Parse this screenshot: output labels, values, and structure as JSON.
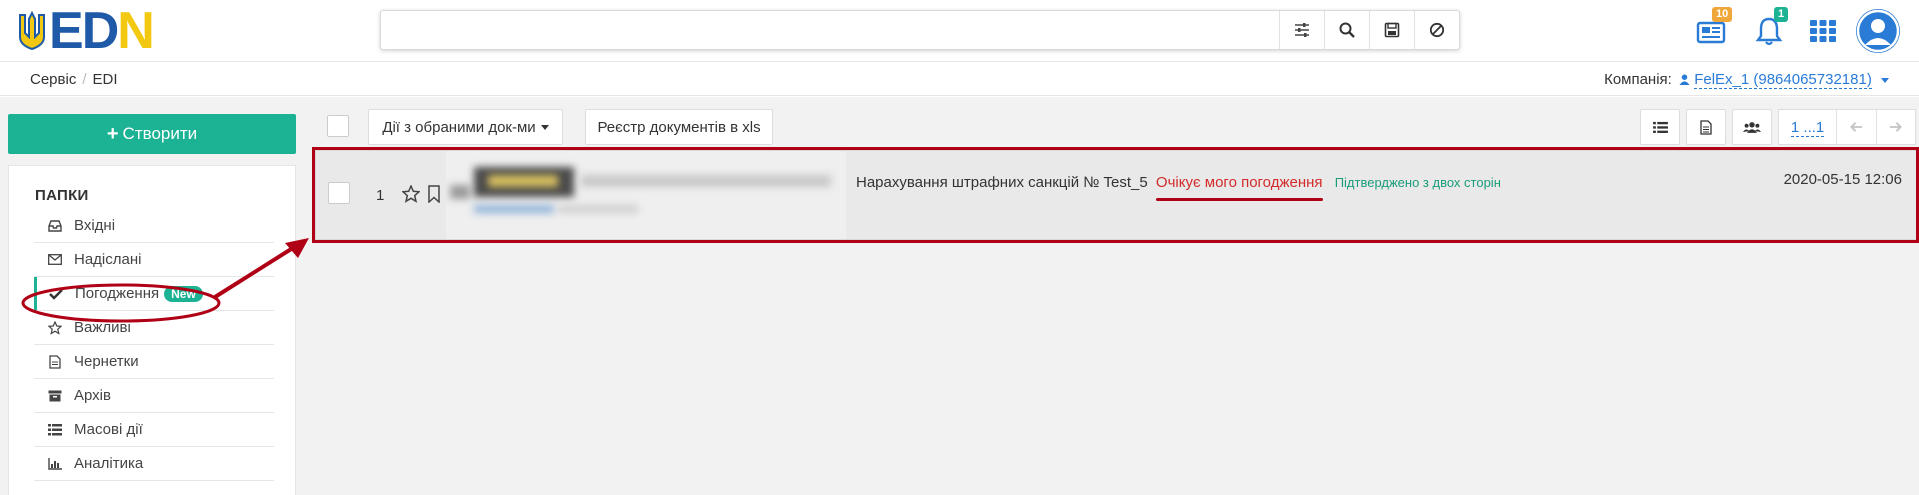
{
  "logo": {
    "text_e": "E",
    "text_d": "D",
    "text_n": "N"
  },
  "search": {
    "placeholder": "",
    "value": ""
  },
  "header": {
    "documents_badge": "10",
    "notifications_badge": "1"
  },
  "breadcrumb": {
    "items": [
      "Сервіс",
      "EDI"
    ]
  },
  "company": {
    "label": "Компанія:",
    "value": "FelEx_1 (9864065732181)"
  },
  "sidebar": {
    "create_label": "Створити",
    "folders_title": "ПАПКИ",
    "items": [
      {
        "label": "Вхідні",
        "icon": "inbox-icon"
      },
      {
        "label": "Надіслані",
        "icon": "envelope-icon"
      },
      {
        "label": "Погодження",
        "icon": "check-icon",
        "badge": "New",
        "active": true
      },
      {
        "label": "Важливі",
        "icon": "star-icon"
      },
      {
        "label": "Чернетки",
        "icon": "file-icon"
      },
      {
        "label": "Архів",
        "icon": "archive-icon"
      },
      {
        "label": "Масові дії",
        "icon": "list-icon"
      },
      {
        "label": "Аналітика",
        "icon": "bar-chart-icon"
      }
    ]
  },
  "toolbar": {
    "bulk_actions_label": "Дії з обраними док-ми",
    "export_label": "Реєстр документів в xls",
    "pager_label": "1 ...1"
  },
  "document": {
    "row_number": "1",
    "title": "Нарахування штрафних санкцій № Test_5",
    "status": "Очікує мого погодження",
    "confirmation": "Підтверджено з двох сторін",
    "date": "2020-05-15 12:06"
  },
  "colors": {
    "accent": "#1bb394",
    "link": "#2a7bd6",
    "status_red": "#d32a2a",
    "annotation": "#b00016"
  }
}
